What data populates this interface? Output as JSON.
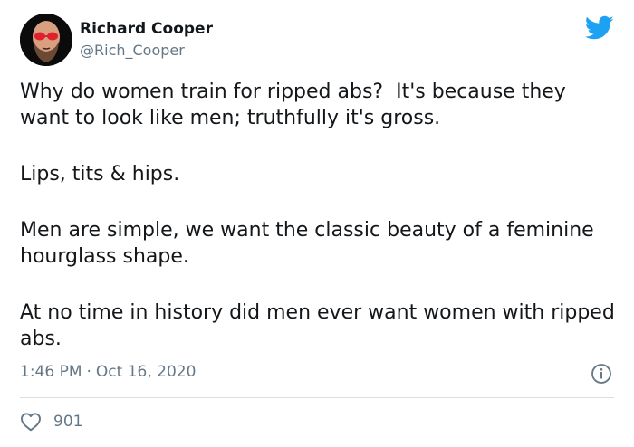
{
  "author": {
    "name": "Richard Cooper",
    "handle": "@Rich_Cooper",
    "avatar_icon": "bald-bearded-man-avatar"
  },
  "tweet": {
    "paragraphs": [
      "Why do women train for ripped abs?  It's because they want to look like men; truthfully it's gross.",
      "Lips, tits & hips.",
      "Men are simple, we want the classic beauty of a feminine hourglass shape.",
      "At no time in history did men ever want women with ripped abs."
    ],
    "time": "1:46 PM",
    "separator": "·",
    "date": "Oct 16, 2020",
    "likes": "901"
  },
  "icons": {
    "brand": "twitter-bird-icon",
    "info": "info-icon",
    "like": "heart-icon"
  },
  "colors": {
    "brand_blue": "#1da1f2",
    "text": "#14171a",
    "secondary_text": "#657786",
    "divider": "#d9dee2"
  }
}
